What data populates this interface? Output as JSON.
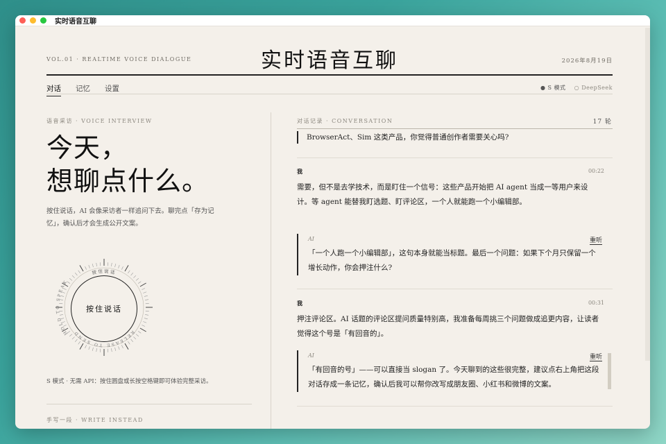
{
  "window": {
    "title": "实时语音互聊"
  },
  "masthead": {
    "vol": "VOL.01 · REALTIME VOICE DIALOGUE",
    "title": "实时语音互聊",
    "date": "2026年8月19日"
  },
  "nav": {
    "tabs": [
      {
        "label": "对话",
        "active": true
      },
      {
        "label": "记忆",
        "active": false
      },
      {
        "label": "设置",
        "active": false
      }
    ],
    "mode_active": "● S 模式",
    "mode_inactive": "○ DeepSeek"
  },
  "left": {
    "kicker": "语音采访 · VOICE INTERVIEW",
    "headline_line1": "今天，",
    "headline_line2": "想聊点什么。",
    "intro": "按住说话，AI 会像采访者一样追问下去。聊完点「存为记忆」，确认后才会生成公开文案。",
    "dial_top_text": "按住说话",
    "dial_left_text": "HOLD TO SPEAK",
    "dial_bottom_text": "RELEASE TO SEND",
    "talk_button": "按住说话",
    "s_mode_note": "S 模式 · 无需 API：按住圆盘或长按空格键即可体验完整采访。",
    "write_kicker": "手写一段 · WRITE INSTEAD"
  },
  "conversation": {
    "kicker": "对话记录 · CONVERSATION",
    "rounds": "17 轮",
    "top_quote": "BrowserAct、Sim 这类产品，你觉得普通创作者需要关心吗?",
    "messages": [
      {
        "who": "我",
        "time": "00:22",
        "text": "需要，但不是去学技术，而是盯住一个信号：这些产品开始把 AI agent 当成一等用户来设计。等 agent 能替我盯选题、盯评论区，一个人就能跑一个小编辑部。",
        "ai_label": "AI",
        "relisten": "重听",
        "ai_text": "「一个人跑一个小编辑部」，这句本身就能当标题。最后一个问题：如果下个月只保留一个增长动作，你会押注什么?"
      },
      {
        "who": "我",
        "time": "00:31",
        "text": "押注评论区。AI 话题的评论区提问质量特别高，我准备每周挑三个问题做成追更内容，让读者觉得这个号是「有回音的」。",
        "ai_label": "AI",
        "relisten": "重听",
        "ai_text": "「有回音的号」——可以直接当 slogan 了。今天聊到的这些很完整，建议点右上角把这段对话存成一条记忆，确认后我可以帮你改写成朋友圈、小红书和微博的文案。"
      }
    ]
  }
}
